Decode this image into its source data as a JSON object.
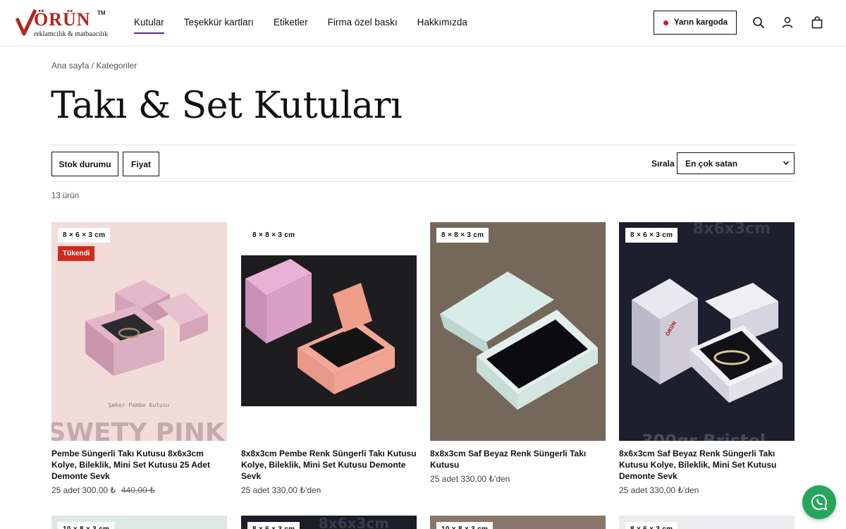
{
  "brand": {
    "name": "ÖRÜN",
    "tm": "TM",
    "tagline": "reklamcılık & matbaacılık"
  },
  "nav": [
    {
      "label": "Kutular",
      "active": true
    },
    {
      "label": "Teşekkür kartları",
      "active": false
    },
    {
      "label": "Etiketler",
      "active": false
    },
    {
      "label": "Firma özel baskı",
      "active": false
    },
    {
      "label": "Hakkımızda",
      "active": false
    }
  ],
  "header": {
    "cargo_label": "Yarın kargoda",
    "icons": [
      "search-icon",
      "account-icon",
      "cart-icon"
    ]
  },
  "breadcrumb": {
    "home": "Ana sayfa",
    "separator": " / ",
    "current": "Kategoriler"
  },
  "page": {
    "title": "Takı & Set Kutuları",
    "count": "13 ürün"
  },
  "filters": {
    "stock": "Stok durumu",
    "price": "Fiyat",
    "sort_label": "Sırala",
    "sort_value": "En çok satan"
  },
  "products": [
    {
      "size": "8 × 6 × 3 cm",
      "sold_out": "Tükendi",
      "title": "Pembe Süngerli Takı Kutusu 8x6x3cm Kolye, Bileklik, Mini Set Kutusu 25 Adet Demonte Sevk",
      "price": "25 adet 300,00 ₺",
      "old_price": "440,00 ₺",
      "img_caption": "Şeker Pembe Kutusu",
      "img_overlay": "SWETY PINK"
    },
    {
      "size": "8 × 8 × 3 cm",
      "title": "8x8x3cm Pembe Renk Süngerli Takı Kutusu Kolye, Bileklik, Mini Set Kutusu Demonte Sevk",
      "price": "25 adet 330,00 ₺'den"
    },
    {
      "size": "8 × 8 × 3 cm",
      "title": "8x8x3cm Saf Beyaz Renk Süngerli Takı Kutusu",
      "price": "25 adet 330,00 ₺'den"
    },
    {
      "size": "8 × 6 × 3 cm",
      "title": "8x6x3cm Saf Beyaz Renk Süngerli Takı Kutusu Kolye, Bileklik, Mini Set Kutusu Demonte Sevk",
      "price": "25 adet 330,00 ₺'den",
      "img_overlay_top": "8x6x3cm",
      "img_overlay_bottom": "300gr Bristol",
      "box_label": "ÖRÜN"
    }
  ],
  "row2": [
    {
      "size": "10 × 8 × 3 cm"
    },
    {
      "size": "8 × 6 × 3 cm",
      "img_overlay_top": "8x6x3cm"
    },
    {
      "size": "10 × 8 × 3 cm"
    },
    {
      "size": "8 × 6 × 3 cm"
    }
  ],
  "colors": {
    "accent": "#5b2a86",
    "sold_out": "#d02a1f",
    "cargo_dot": "#d21f1f",
    "whatsapp": "#26a65b",
    "logo": "#b3261e"
  }
}
